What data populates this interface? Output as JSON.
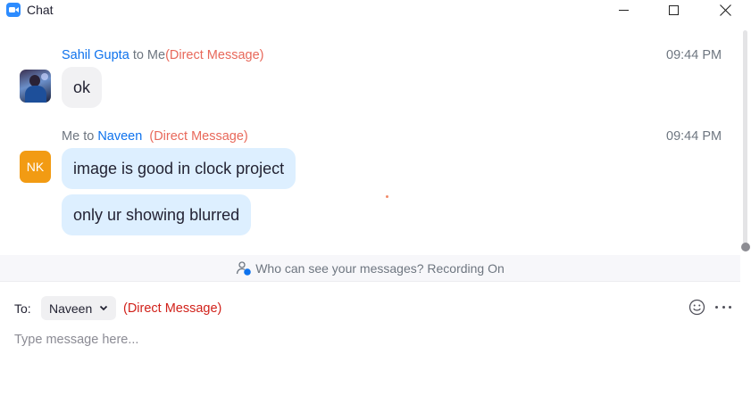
{
  "window": {
    "title": "Chat"
  },
  "messages": [
    {
      "sender": "Sahil Gupta",
      "connector": "to Me",
      "tag": "(Direct Message)",
      "time": "09:44 PM",
      "bubbles": [
        "ok"
      ]
    },
    {
      "sender": "Me",
      "connector": "to",
      "recipient": "Naveen",
      "tag": "(Direct Message)",
      "time": "09:44 PM",
      "avatar_initials": "NK",
      "bubbles": [
        "image is good in clock project",
        "only ur showing blurred"
      ]
    }
  ],
  "notice": {
    "text": "Who can see your messages? Recording On"
  },
  "composer": {
    "to_label": "To:",
    "recipient": "Naveen",
    "tag": "(Direct Message)",
    "placeholder": "Type message here..."
  },
  "colors": {
    "accent_blue": "#0e72ed",
    "dm_tag": "#e8685a",
    "dm_tag_composer": "#d1211a",
    "outgoing_bubble": "#ddefff",
    "incoming_bubble": "#f1f1f3",
    "avatar_nk": "#f29b13"
  }
}
